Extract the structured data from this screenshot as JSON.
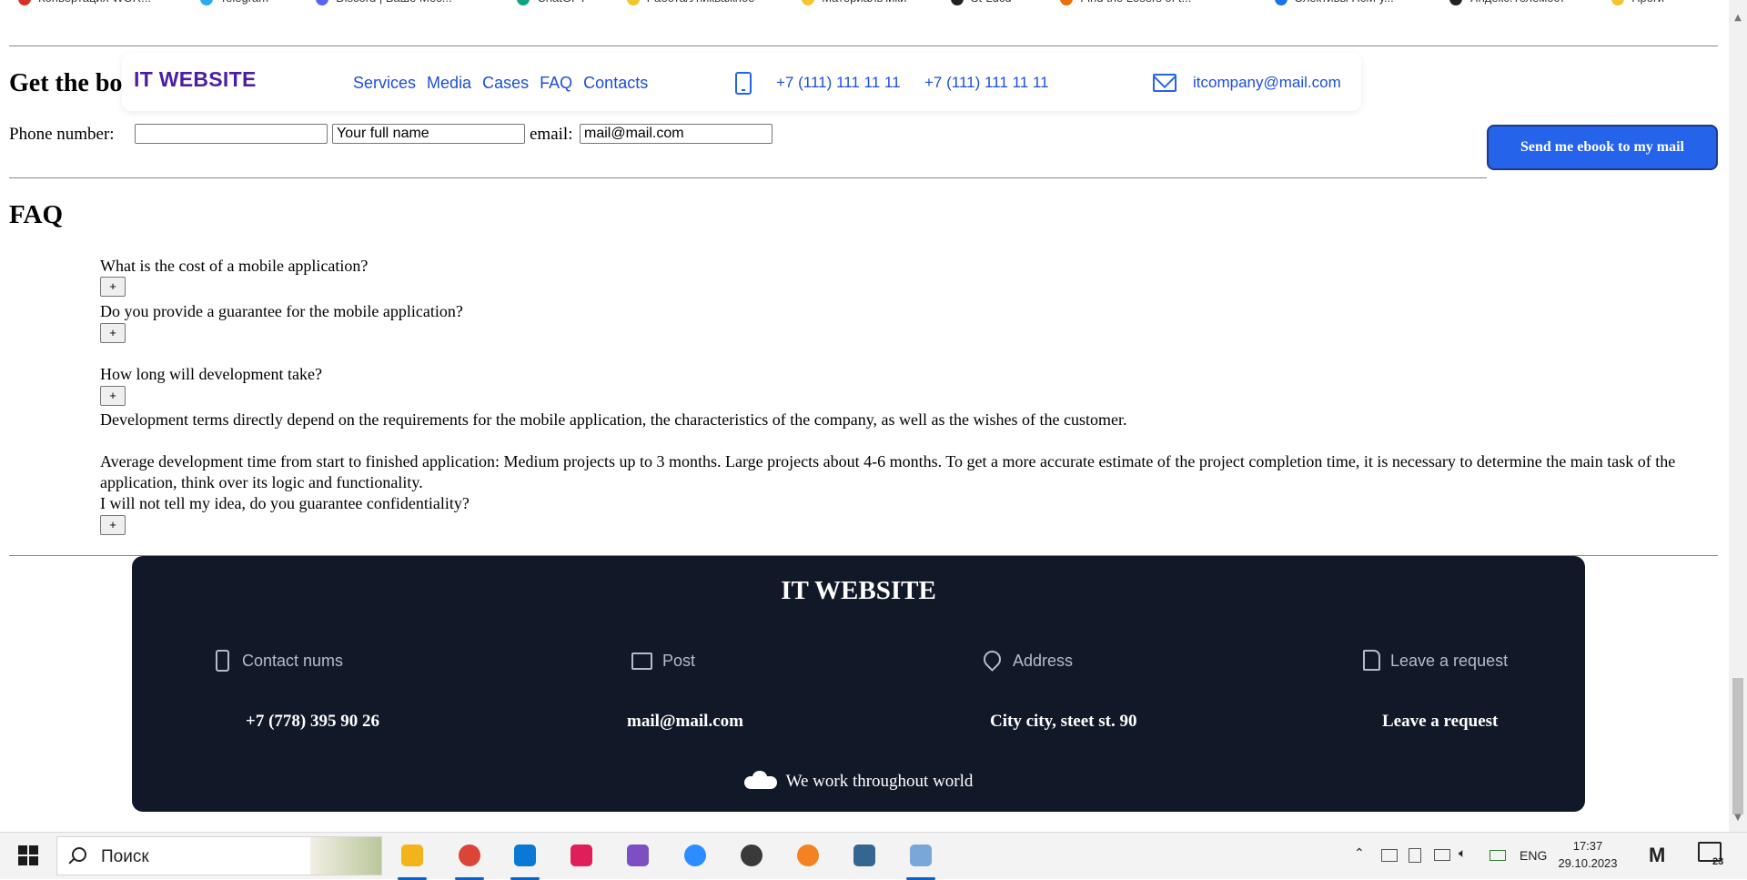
{
  "browser": {
    "bookmarks": [
      {
        "label": "Конвертация WOR...",
        "color": "#d93025"
      },
      {
        "label": "Telegram",
        "color": "#2aabee"
      },
      {
        "label": "Discord | Ваше Мес...",
        "color": "#5865f2"
      },
      {
        "label": "ChatGPT",
        "color": "#10a37f"
      },
      {
        "label": "Работа/Уникважное",
        "color": "#f4c430"
      },
      {
        "label": "Материальчики",
        "color": "#f4c430"
      },
      {
        "label": "St-Lucu",
        "color": "#222222"
      },
      {
        "label": "Find the Losers of t...",
        "color": "#e8710a"
      },
      {
        "label": "Элективы ПсМ у...",
        "color": "#1a73e8"
      },
      {
        "label": "Яндекс.Телемост",
        "color": "#222222"
      },
      {
        "label": "Проги",
        "color": "#f4c430"
      }
    ]
  },
  "header": {
    "brand": "IT WEBSITE",
    "nav": [
      "Services",
      "Media",
      "Cases",
      "FAQ",
      "Contacts"
    ],
    "phone1": "+7 (111) 111 11 11",
    "phone2": "+7 (111) 111 11 11",
    "email": "itcompany@mail.com"
  },
  "ebook": {
    "title": "Get the bo",
    "phone_label": "Phone number:",
    "phone_value": "",
    "name_value": "Your full name",
    "email_label": "email:",
    "email_value": "mail@mail.com",
    "send_label": "Send me ebook to my mail"
  },
  "faq": {
    "title": "FAQ",
    "toggle_label": "+",
    "items": [
      {
        "question": "What is the cost of a mobile application?"
      },
      {
        "question": "Do you provide a guarantee for the mobile application?"
      },
      {
        "question": "How long will development take?"
      },
      {
        "question": "I will not tell my idea, do you guarantee confidentiality?"
      }
    ],
    "answer_p1": "Development terms directly depend on the requirements for the mobile application, the characteristics of the company, as well as the wishes of the customer.",
    "answer_p2": "Average development time from start to finished application: Medium projects up to 3 months. Large projects about 4-6 months. To get a more accurate estimate of the project completion time, it is necessary to determine the main task of the application, think over its logic and functionality."
  },
  "footer": {
    "title": "IT WEBSITE",
    "columns": [
      {
        "label": "Contact nums",
        "value": "+7 (778) 395 90 26",
        "icon": "phone-icon"
      },
      {
        "label": "Post",
        "value": "mail@mail.com",
        "icon": "mail-icon"
      },
      {
        "label": "Address",
        "value": "City city, steet st. 90",
        "icon": "location-pin-icon"
      },
      {
        "label": "Leave a request",
        "value": "Leave a request",
        "icon": "document-icon"
      }
    ],
    "world": "We work throughout world"
  },
  "taskbar": {
    "search_text": "Поиск",
    "lang": "ENG",
    "time": "17:37",
    "date": "29.10.2023",
    "notifications": "23",
    "apps": [
      {
        "name": "file-explorer",
        "color": "#f2b41a"
      },
      {
        "name": "chrome",
        "color": "#db4437"
      },
      {
        "name": "vscode",
        "color": "#0a78d4"
      },
      {
        "name": "slack",
        "color": "#e01e5a"
      },
      {
        "name": "visual-studio",
        "color": "#7e4fc3"
      },
      {
        "name": "zoom",
        "color": "#2d8cff"
      },
      {
        "name": "app-dark",
        "color": "#3a3a3a"
      },
      {
        "name": "app-orange",
        "color": "#f58220"
      },
      {
        "name": "postgres",
        "color": "#336791"
      },
      {
        "name": "paint",
        "color": "#7aa7d9"
      }
    ]
  }
}
